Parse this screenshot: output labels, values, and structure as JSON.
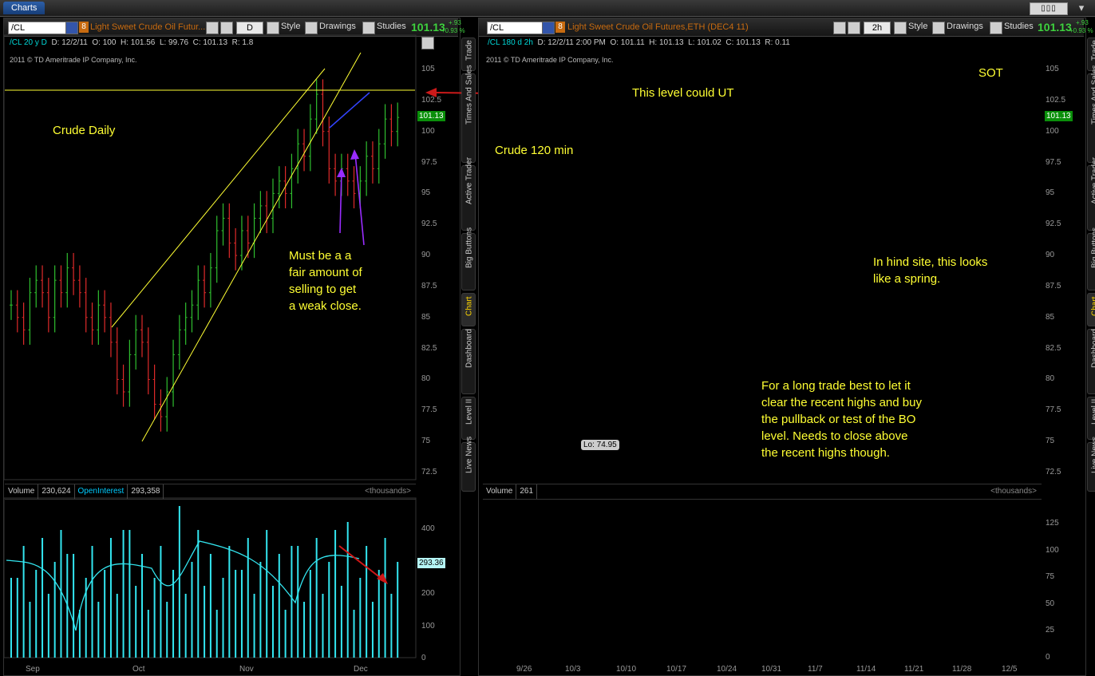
{
  "app": {
    "tab_label": "Charts"
  },
  "left": {
    "symbol": "/CL",
    "badge": "8",
    "description": "Light Sweet Crude Oil Futur...",
    "period": "D",
    "style_label": "Style",
    "drawings_label": "Drawings",
    "studies_label": "Studies",
    "last": "101.13",
    "change1": "+.93",
    "change2": "+0.93 %",
    "info": {
      "name": "/CL 20 y D",
      "date": "D: 12/2/11",
      "open": "O: 100",
      "high": "H: 101.56",
      "low": "L: 99.76",
      "close": "C: 101.13",
      "range": "R: 1.8"
    },
    "copyright": "2011 © TD Ameritrade IP Company, Inc.",
    "price_tag": "101.13",
    "y_axis": [
      "105",
      "102.5",
      "100",
      "97.5",
      "95",
      "92.5",
      "90",
      "87.5",
      "85",
      "82.5",
      "80",
      "77.5",
      "75",
      "72.5"
    ],
    "annotations": {
      "title": "Crude Daily",
      "note": [
        "Must be a a",
        "fair amount of",
        "selling to get",
        "a weak close."
      ]
    },
    "volume": {
      "label": "Volume",
      "value": "230,624",
      "oi_label": "OpenInterest",
      "oi_value": "293,358",
      "units": "<thousands>",
      "tag": "293.36",
      "y_axis": [
        "400",
        "300",
        "200",
        "100",
        "0"
      ]
    },
    "x_axis": [
      "Sep",
      "Oct",
      "Nov",
      "Dec"
    ]
  },
  "right": {
    "symbol": "/CL",
    "badge": "8",
    "description": "Light Sweet Crude Oil Futures,ETH (DEC4 11)",
    "period": "2h",
    "style_label": "Style",
    "drawings_label": "Drawings",
    "studies_label": "Studies",
    "last": "101.13",
    "change1": "+.93",
    "change2": "+0.93 %",
    "info": {
      "name": "/CL 180 d 2h",
      "date": "D: 12/2/11 2:00 PM",
      "open": "O: 101.11",
      "high": "H: 101.13",
      "low": "L: 101.02",
      "close": "C: 101.13",
      "range": "R: 0.11"
    },
    "copyright": "2011 © TD Ameritrade IP Company, Inc.",
    "price_tag": "101.13",
    "y_axis": [
      "105",
      "102.5",
      "100",
      "97.5",
      "95",
      "92.5",
      "90",
      "87.5",
      "85",
      "82.5",
      "80",
      "77.5",
      "75",
      "72.5"
    ],
    "annotations": {
      "title": "Crude 120 min",
      "level": "This level could UT",
      "sot": "SOT",
      "spring": [
        "In hind site, this looks",
        "like a spring."
      ],
      "trade": [
        "For a long trade best to let it",
        "clear the recent highs and buy",
        "the pullback or test of the BO",
        "level.  Needs to close above",
        "the recent highs though."
      ],
      "low_tag": "Lo: 74.95"
    },
    "volume": {
      "label": "Volume",
      "value": "261",
      "units": "<thousands>",
      "y_axis": [
        "125",
        "100",
        "75",
        "50",
        "25",
        "0"
      ]
    },
    "x_axis": [
      "9/26",
      "10/3",
      "10/10",
      "10/17",
      "10/24",
      "10/31",
      "11/7",
      "11/14",
      "11/21",
      "11/28",
      "12/5"
    ]
  },
  "side_tabs": [
    "Trade",
    "Times And Sales",
    "Active Trader",
    "Big Buttons",
    "Chart",
    "Dashboard",
    "Level II",
    "Live News"
  ],
  "colors": {
    "up": "#2fbf2f",
    "down": "#e02a2a",
    "line": "#ffff33",
    "channel": "#33d6e6",
    "volume": "#33e6f0"
  },
  "chart_data": [
    {
      "type": "bar",
      "subtype": "ohlc",
      "title": "Crude Daily",
      "x_labels": [
        "Sep",
        "Oct",
        "Nov",
        "Dec"
      ],
      "ylim": [
        72.5,
        105
      ],
      "last": 101.13,
      "closes": [
        86,
        85,
        84,
        87,
        88,
        87,
        85,
        88,
        87,
        89,
        88,
        87,
        85,
        84,
        86,
        85,
        83,
        80,
        79,
        82,
        84,
        83,
        80,
        78,
        77,
        79,
        82,
        84,
        85,
        86,
        88,
        87,
        89,
        92,
        93,
        91,
        90,
        92,
        91,
        93,
        94,
        93,
        95,
        96,
        95,
        97,
        99,
        98,
        101,
        103,
        100,
        97,
        96,
        97,
        96,
        95,
        96,
        98,
        97,
        99,
        101,
        100,
        101.13
      ]
    },
    {
      "type": "bar",
      "subtype": "ohlc",
      "title": "Crude 120 min",
      "x_labels": [
        "9/26",
        "10/3",
        "10/10",
        "10/17",
        "10/24",
        "10/31",
        "11/7",
        "11/14",
        "11/21",
        "11/28",
        "12/5"
      ],
      "ylim": [
        72.5,
        105
      ],
      "last": 101.13,
      "low": 74.95
    }
  ]
}
